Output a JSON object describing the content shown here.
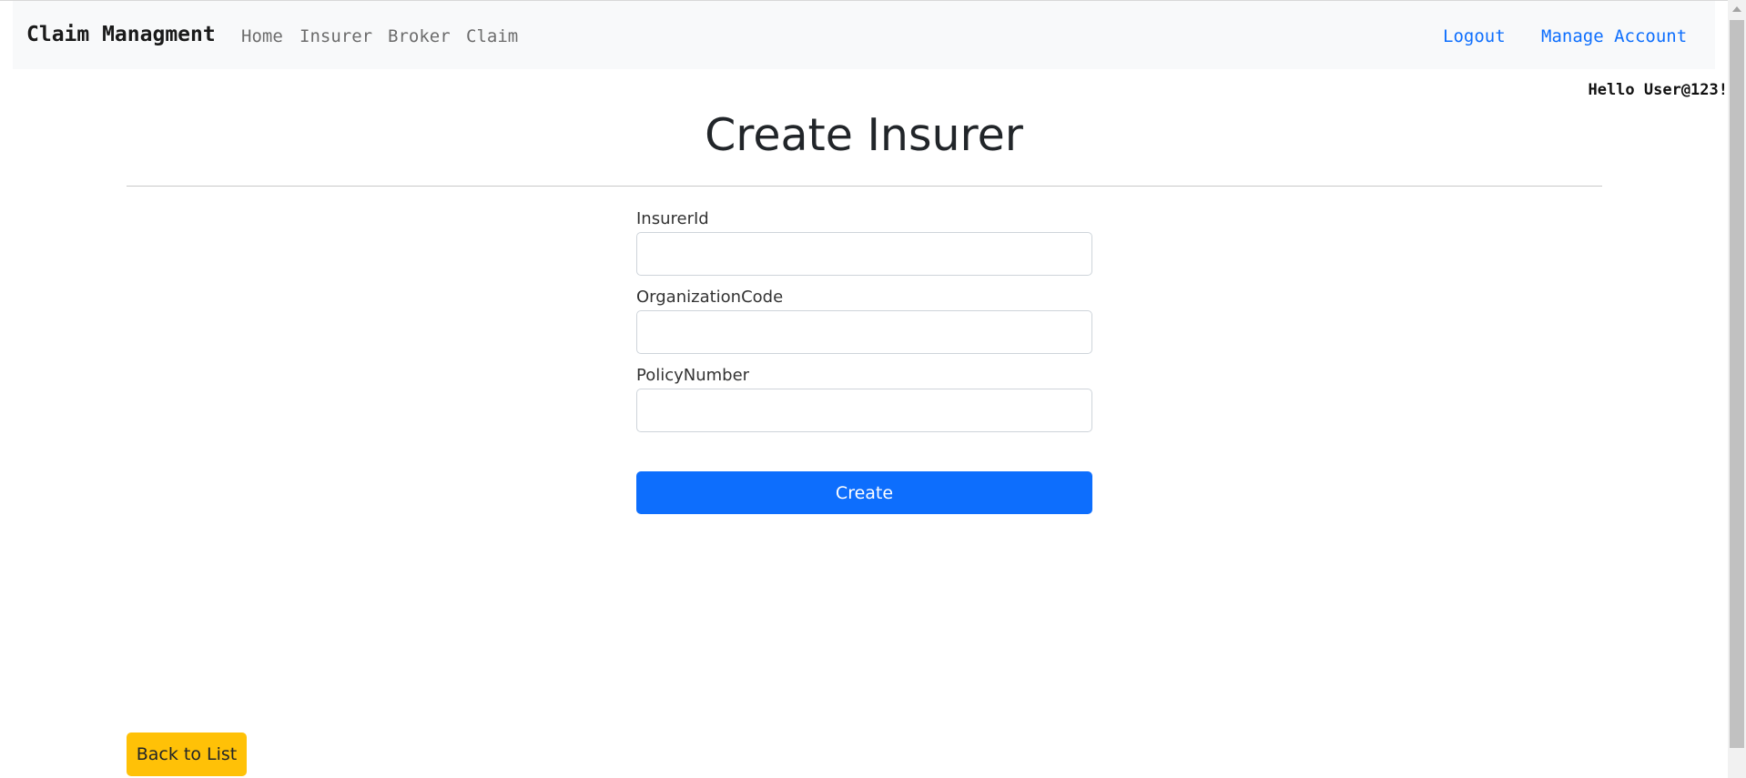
{
  "navbar": {
    "brand": "Claim Managment",
    "links": [
      "Home",
      "Insurer",
      "Broker",
      "Claim"
    ],
    "logout": "Logout",
    "manage_account": "Manage Account"
  },
  "greeting": "Hello User@123!",
  "page": {
    "title": "Create Insurer"
  },
  "form": {
    "fields": [
      {
        "label": "InsurerId",
        "value": "",
        "placeholder": ""
      },
      {
        "label": "OrganizationCode",
        "value": "",
        "placeholder": ""
      },
      {
        "label": "PolicyNumber",
        "value": "",
        "placeholder": ""
      }
    ],
    "submit_label": "Create"
  },
  "back_label": "Back to List",
  "colors": {
    "primary": "#0d6efd",
    "warning": "#ffc107",
    "navbar_bg": "#f8f9fa"
  }
}
